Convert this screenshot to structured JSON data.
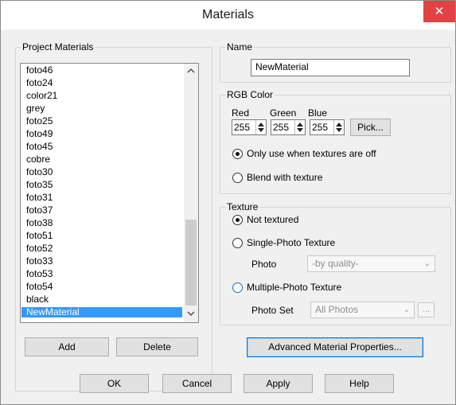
{
  "window": {
    "title": "Materials",
    "close_glyph": "✕"
  },
  "project_materials": {
    "legend": "Project Materials",
    "items": [
      "foto46",
      "foto24",
      "color21",
      "grey",
      "foto25",
      "foto49",
      "foto45",
      "cobre",
      "foto30",
      "foto35",
      "foto31",
      "foto37",
      "foto38",
      "foto51",
      "foto52",
      "foto33",
      "foto53",
      "foto54",
      "black",
      "NewMaterial"
    ],
    "selected": "NewMaterial",
    "add_label": "Add",
    "delete_label": "Delete"
  },
  "name_group": {
    "legend": "Name",
    "value": "NewMaterial"
  },
  "rgb": {
    "legend": "RGB Color",
    "red_label": "Red",
    "green_label": "Green",
    "blue_label": "Blue",
    "red": "255",
    "green": "255",
    "blue": "255",
    "pick_label": "Pick...",
    "options": [
      "Only use when textures are off",
      "Blend with texture"
    ],
    "selected_option": "Only use when textures are off"
  },
  "texture": {
    "legend": "Texture",
    "not_textured": "Not textured",
    "single_photo": "Single-Photo Texture",
    "photo_label": "Photo",
    "photo_value": "-by quality-",
    "multi_photo": "Multiple-Photo Texture",
    "photo_set_label": "Photo Set",
    "photo_set_value": "All Photos",
    "ellipsis": "...",
    "selected": "Not textured"
  },
  "advanced_label": "Advanced Material Properties...",
  "footer": {
    "ok": "OK",
    "cancel": "Cancel",
    "apply": "Apply",
    "help": "Help"
  }
}
